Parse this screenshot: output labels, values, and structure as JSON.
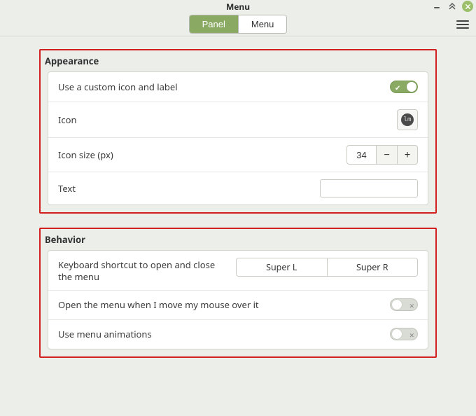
{
  "window": {
    "title": "Menu"
  },
  "tabs": {
    "panel": "Panel",
    "menu": "Menu",
    "active": "panel"
  },
  "appearance": {
    "legend": "Appearance",
    "custom_icon_label": "Use a custom icon and label",
    "custom_icon_on": true,
    "icon_label": "Icon",
    "icon_size_label": "Icon size (px)",
    "icon_size_value": "34",
    "text_label": "Text",
    "text_value": ""
  },
  "behavior": {
    "legend": "Behavior",
    "shortcut_label": "Keyboard shortcut to open and close the menu",
    "shortcut_left": "Super L",
    "shortcut_right": "Super R",
    "hover_label": "Open the menu when I move my mouse over it",
    "hover_on": false,
    "anim_label": "Use menu animations",
    "anim_on": false
  }
}
